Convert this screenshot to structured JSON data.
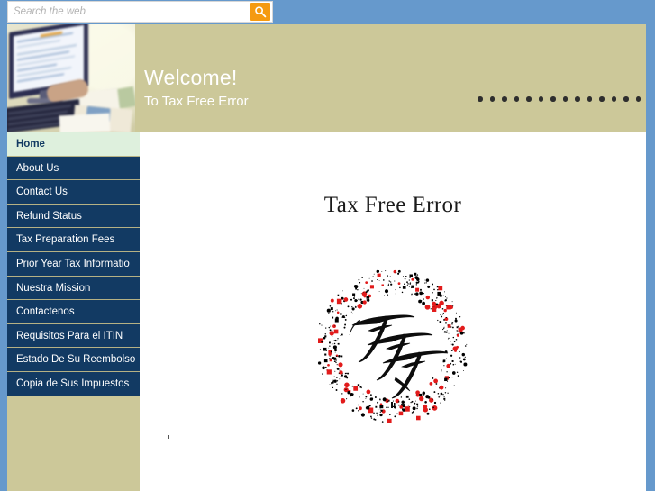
{
  "search": {
    "placeholder": "Search the web",
    "value": "",
    "button_icon": "search-icon"
  },
  "header": {
    "title": "Welcome!",
    "subtitle": "To Tax Free Error",
    "photo_alt": "computer-desk-photo",
    "dot_count": 15,
    "background_color": "#ccc899",
    "text_color": "#ffffff"
  },
  "sidebar": {
    "active_index": 0,
    "background_color": "#123a63",
    "active_background_color": "#def0dd",
    "items": [
      {
        "label": "Home"
      },
      {
        "label": "About Us"
      },
      {
        "label": "Contact Us"
      },
      {
        "label": "Refund Status"
      },
      {
        "label": "Tax Preparation Fees"
      },
      {
        "label": "Prior Year Tax Informatio"
      },
      {
        "label": "Nuestra Mission"
      },
      {
        "label": "Contactenos"
      },
      {
        "label": "Requisitos Para el ITIN"
      },
      {
        "label": "Estado De Su Reembolso"
      },
      {
        "label": "Copia de Sus Impuestos"
      }
    ]
  },
  "main": {
    "title": "Tax Free Error",
    "logo": {
      "name": "tax-free-error-monogram-logo",
      "monogram": "TFE",
      "ring_colors": [
        "#000000",
        "#e21b1b"
      ]
    }
  },
  "theme": {
    "top_bar": "#6699cc",
    "banner": "#ccc899",
    "nav": "#123a63",
    "accent_orange": "#f59a11"
  }
}
